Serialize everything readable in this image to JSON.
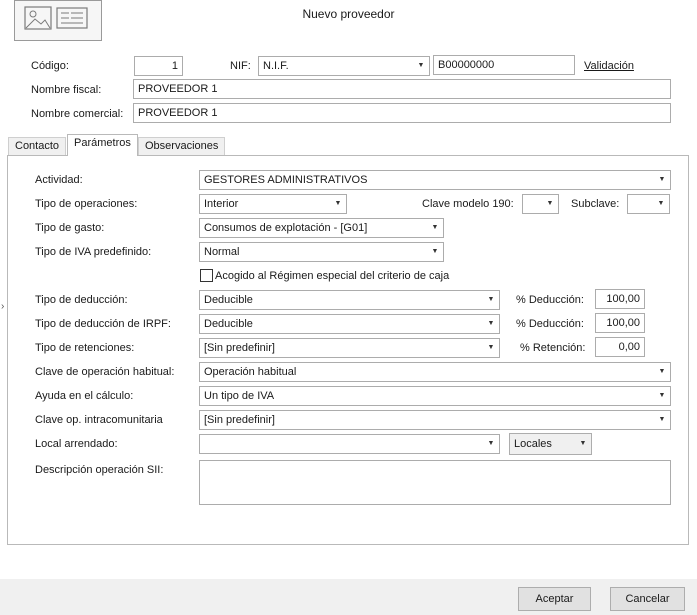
{
  "window": {
    "title": "Nuevo proveedor"
  },
  "header": {
    "codigo_label": "Código:",
    "codigo_value": "1",
    "nif_label": "NIF:",
    "nif_type": "N.I.F.",
    "nif_value": "B00000000",
    "validacion_link": "Validación",
    "nombre_fiscal_label": "Nombre fiscal:",
    "nombre_fiscal_value": "PROVEEDOR 1",
    "nombre_comercial_label": "Nombre comercial:",
    "nombre_comercial_value": "PROVEEDOR 1"
  },
  "tabs": [
    {
      "label": "Contacto"
    },
    {
      "label": "Parámetros"
    },
    {
      "label": "Observaciones"
    }
  ],
  "params": {
    "actividad_label": "Actividad:",
    "actividad_value": "GESTORES ADMINISTRATIVOS",
    "tipo_operaciones_label": "Tipo de operaciones:",
    "tipo_operaciones_value": "Interior",
    "clave_modelo_label": "Clave modelo 190:",
    "clave_modelo_value": "",
    "subclave_label": "Subclave:",
    "subclave_value": "",
    "tipo_gasto_label": "Tipo de gasto:",
    "tipo_gasto_value": "Consumos de explotación - [G01]",
    "tipo_iva_label": "Tipo de IVA predefinido:",
    "tipo_iva_value": "Normal",
    "criterio_caja_label": "Acogido al Régimen especial del criterio de caja",
    "criterio_caja_checked": false,
    "tipo_deduccion_label": "Tipo de deducción:",
    "tipo_deduccion_value": "Deducible",
    "pct_deduccion_label": "% Deducción:",
    "pct_deduccion_value": "100,00",
    "tipo_deduccion_irpf_label": "Tipo de deducción de IRPF:",
    "tipo_deduccion_irpf_value": "Deducible",
    "pct_deduccion_irpf_label": "% Deducción:",
    "pct_deduccion_irpf_value": "100,00",
    "tipo_retenciones_label": "Tipo de retenciones:",
    "tipo_retenciones_value": "[Sin predefinir]",
    "pct_retencion_label": "% Retención:",
    "pct_retencion_value": "0,00",
    "clave_operacion_label": "Clave de operación habitual:",
    "clave_operacion_value": "Operación habitual",
    "ayuda_calculo_label": "Ayuda en el cálculo:",
    "ayuda_calculo_value": "Un tipo de IVA",
    "clave_intracom_label": "Clave op. intracomunitaria",
    "clave_intracom_value": "[Sin predefinir]",
    "local_arrendado_label": "Local arrendado:",
    "local_arrendado_value": "",
    "locales_button": "Locales",
    "descripcion_sii_label": "Descripción operación SII:",
    "descripcion_sii_value": ""
  },
  "footer": {
    "accept_label": "Aceptar",
    "cancel_label": "Cancelar"
  },
  "icons": {
    "dropdown": "chevron-down-icon",
    "logo": "image-placeholder-icon",
    "side_expander": "chevron-right-icon"
  }
}
